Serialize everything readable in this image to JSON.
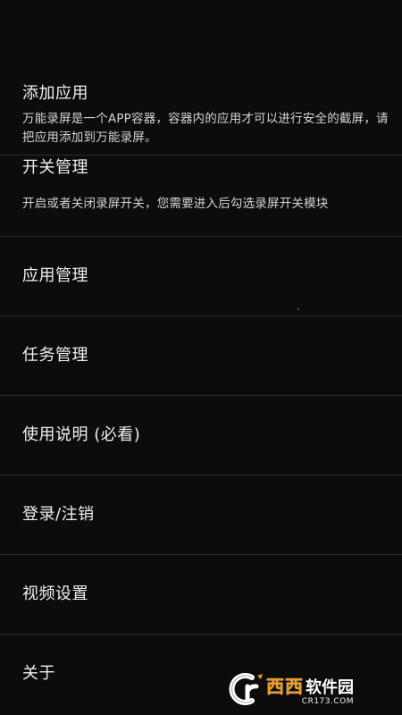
{
  "menu": {
    "items": [
      {
        "title": "添加应用",
        "description": "万能录屏是一个APP容器，容器内的应用才可以进行安全的截屏，请把应用添加到万能录屏。"
      },
      {
        "title": "开关管理",
        "description": "开启或者关闭录屏开关，您需要进入后勾选录屏开关模块"
      },
      {
        "title": "应用管理"
      },
      {
        "title": "任务管理"
      },
      {
        "title": "使用说明 (必看)"
      },
      {
        "title": "登录/注销"
      },
      {
        "title": "视频设置"
      },
      {
        "title": "关于"
      }
    ]
  },
  "watermark": {
    "brand_cn": "西西",
    "brand_cn2": "软件园",
    "url": "CR173.COM"
  },
  "colors": {
    "background": "#0c0c0c",
    "divider": "#2c2c2c",
    "text_primary": "#f0f0f0",
    "text_secondary": "#d4d4d4",
    "watermark_orange": "#f39a1e"
  },
  "icons": {
    "watermark_logo": "cr-logo-icon"
  }
}
